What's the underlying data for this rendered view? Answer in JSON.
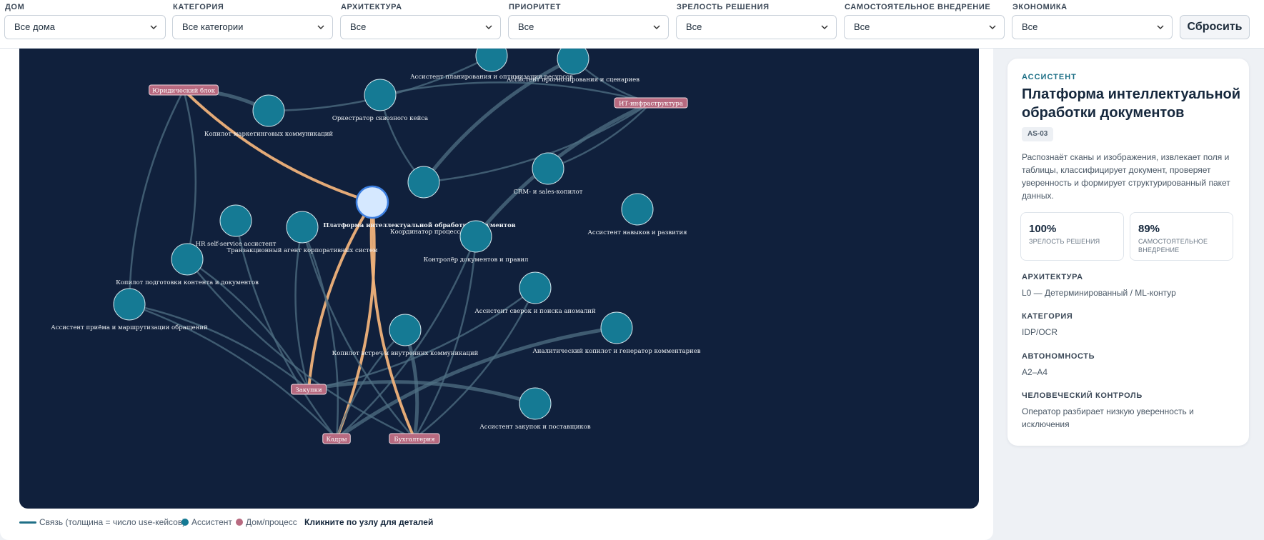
{
  "filters": [
    {
      "label": "ДОМ",
      "value": "Все дома"
    },
    {
      "label": "КАТЕГОРИЯ",
      "value": "Все категории"
    },
    {
      "label": "АРХИТЕКТУРА",
      "value": "Все"
    },
    {
      "label": "ПРИОРИТЕТ",
      "value": "Все"
    },
    {
      "label": "ЗРЕЛОСТЬ РЕШЕНИЯ",
      "value": "Все"
    },
    {
      "label": "САМОСТОЯТЕЛЬНОЕ ВНЕДРЕНИЕ",
      "value": "Все"
    },
    {
      "label": "ЭКОНОМИКА",
      "value": "Все"
    }
  ],
  "reset_label": "Сбросить",
  "graph": {
    "colors": {
      "background": "#10203c",
      "edge": "#4f6f83",
      "edge_highlight": "#f0b27a",
      "assistant_node": "#157a94",
      "selected_node": "#d5e8ff",
      "house_node": "#b86a80"
    },
    "assistants": [
      {
        "id": "a1",
        "label": "Ассистент планирования и оптимизации ресурсов"
      },
      {
        "id": "a2",
        "label": "Ассистент прогнозирования и сценариев"
      },
      {
        "id": "a3",
        "label": "Оркестратор сквозного кейса"
      },
      {
        "id": "a4",
        "label": "Копилот маркетинговых коммуникаций"
      },
      {
        "id": "a5",
        "label": "Координатор процесса и SLA"
      },
      {
        "id": "a6",
        "label": "CRM- и sales-копилот"
      },
      {
        "id": "sel",
        "label": "Платформа интеллектуальной обработки документов",
        "selected": true
      },
      {
        "id": "a7",
        "label": "Ассистент навыков и развития"
      },
      {
        "id": "a8",
        "label": "HR self-service ассистент"
      },
      {
        "id": "a9",
        "label": "Транзакционный агент корпоративных систем"
      },
      {
        "id": "a10",
        "label": "Контролёр документов и правил"
      },
      {
        "id": "a11",
        "label": "Копилот подготовки контента и документов"
      },
      {
        "id": "a12",
        "label": "Ассистент сверок и поиска аномалий"
      },
      {
        "id": "a13",
        "label": "Ассистент приёма и маршрутизации обращений"
      },
      {
        "id": "a14",
        "label": "Копилот встреч и внутренних коммуникаций"
      },
      {
        "id": "a15",
        "label": "Аналитический копилот и генератор комментариев"
      },
      {
        "id": "a16",
        "label": "Ассистент закупок и поставщиков"
      }
    ],
    "houses": [
      {
        "id": "h_legal",
        "label": "Юридический блок"
      },
      {
        "id": "h_it",
        "label": "ИТ-инфраструктура"
      },
      {
        "id": "h_proc",
        "label": "Закупки"
      },
      {
        "id": "h_hr",
        "label": "Кадры"
      },
      {
        "id": "h_acc",
        "label": "Бухгалтерия"
      }
    ]
  },
  "legend": {
    "link": "Связь (толщина = число use-кейсов)",
    "assistant": "Ассистент",
    "house": "Дом/процесс",
    "hint": "Кликните по узлу для деталей"
  },
  "detail": {
    "kicker": "АССИСТЕНТ",
    "title": "Платформа интеллектуальной обработки документов",
    "code": "AS-03",
    "description": "Распознаёт сканы и изображения, извлекает поля и таблицы, классифицирует документ, проверяет уверенность и формирует структурированный пакет данных.",
    "metrics": [
      {
        "value": "100%",
        "label": "ЗРЕЛОСТЬ РЕШЕНИЯ"
      },
      {
        "value": "89%",
        "label": "САМОСТОЯТЕЛЬНОЕ ВНЕДРЕНИЕ"
      }
    ],
    "sections": [
      {
        "title": "АРХИТЕКТУРА",
        "value": "L0 — Детерминированный / ML-контур"
      },
      {
        "title": "КАТЕГОРИЯ",
        "value": "IDP/OCR"
      },
      {
        "title": "АВТОНОМНОСТЬ",
        "value": "A2–A4"
      },
      {
        "title": "ЧЕЛОВЕЧЕСКИЙ КОНТРОЛЬ",
        "value": "Оператор разбирает низкую уверенность и исключения"
      }
    ]
  }
}
